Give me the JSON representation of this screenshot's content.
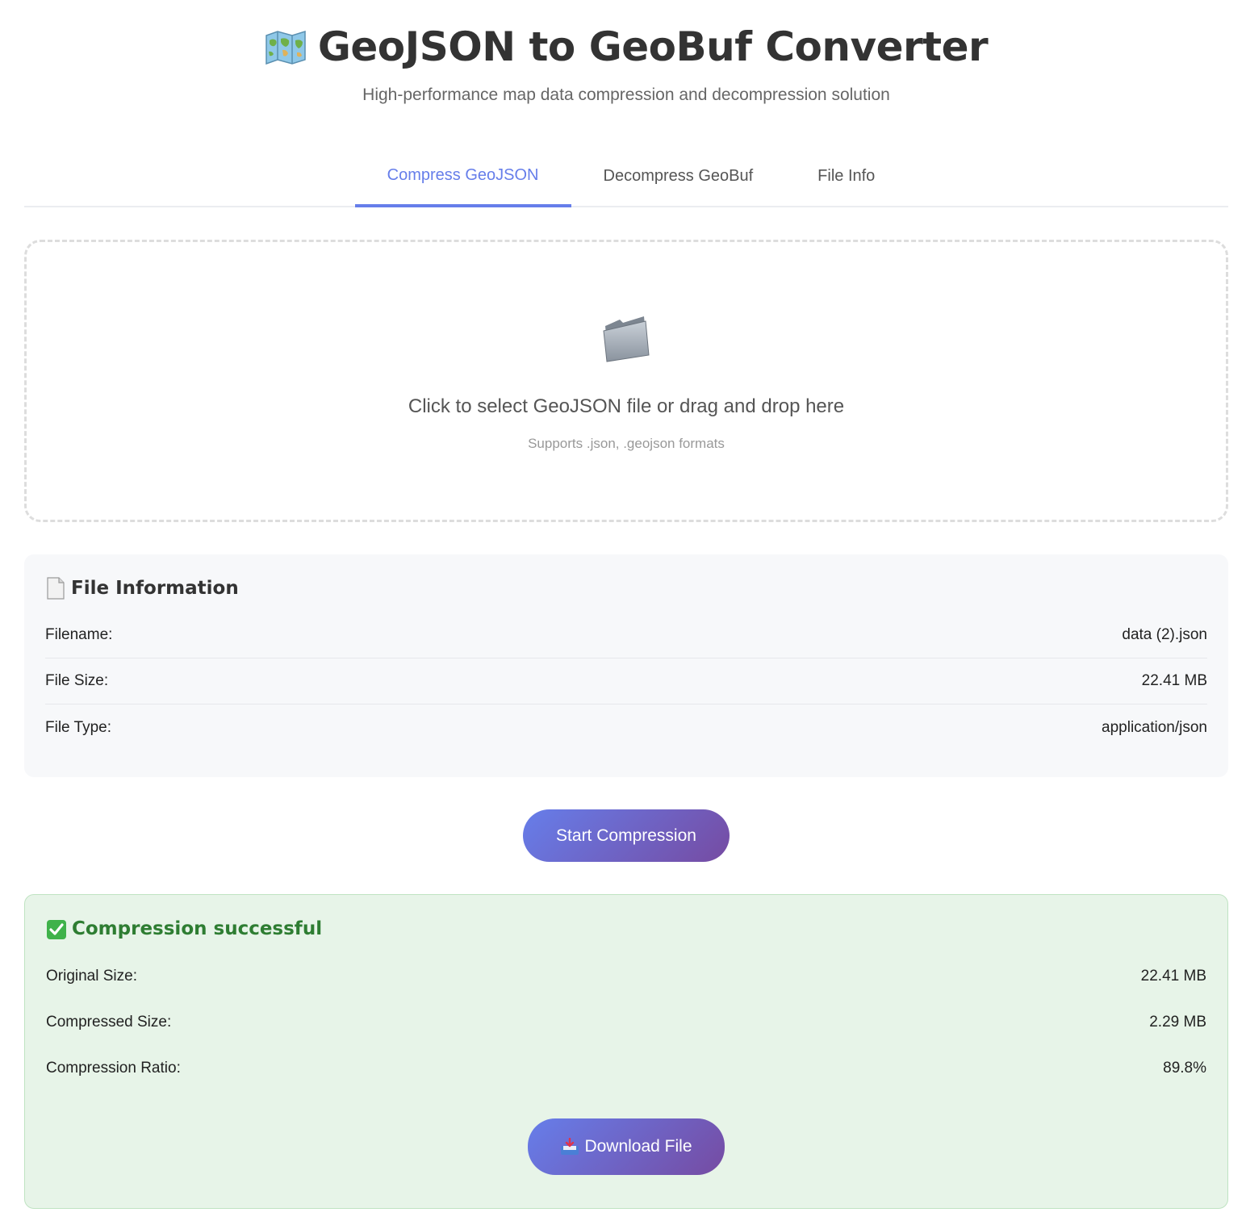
{
  "header": {
    "title": "GeoJSON to GeoBuf Converter",
    "title_icon": "world-map-icon",
    "subtitle": "High-performance map data compression and decompression solution"
  },
  "tabs": [
    {
      "label": "Compress GeoJSON",
      "active": true
    },
    {
      "label": "Decompress GeoBuf",
      "active": false
    },
    {
      "label": "File Info",
      "active": false
    }
  ],
  "upload": {
    "icon": "folder-icon",
    "text": "Click to select GeoJSON file or drag and drop here",
    "hint": "Supports .json, .geojson formats"
  },
  "file_info": {
    "icon": "document-icon",
    "title": "File Information",
    "rows": [
      {
        "label": "Filename:",
        "value": "data (2).json"
      },
      {
        "label": "File Size:",
        "value": "22.41 MB"
      },
      {
        "label": "File Type:",
        "value": "application/json"
      }
    ]
  },
  "start_button": {
    "label": "Start Compression"
  },
  "result": {
    "icon": "check-icon",
    "title": "Compression successful",
    "rows": [
      {
        "label": "Original Size:",
        "value": "22.41 MB"
      },
      {
        "label": "Compressed Size:",
        "value": "2.29 MB"
      },
      {
        "label": "Compression Ratio:",
        "value": "89.8%"
      }
    ],
    "download_icon": "inbox-tray-icon",
    "download_label": "Download File"
  },
  "colors": {
    "accent": "#667eea",
    "gradient_end": "#764ba2",
    "success_text": "#2e7d32",
    "success_bg": "#e7f4e8"
  }
}
